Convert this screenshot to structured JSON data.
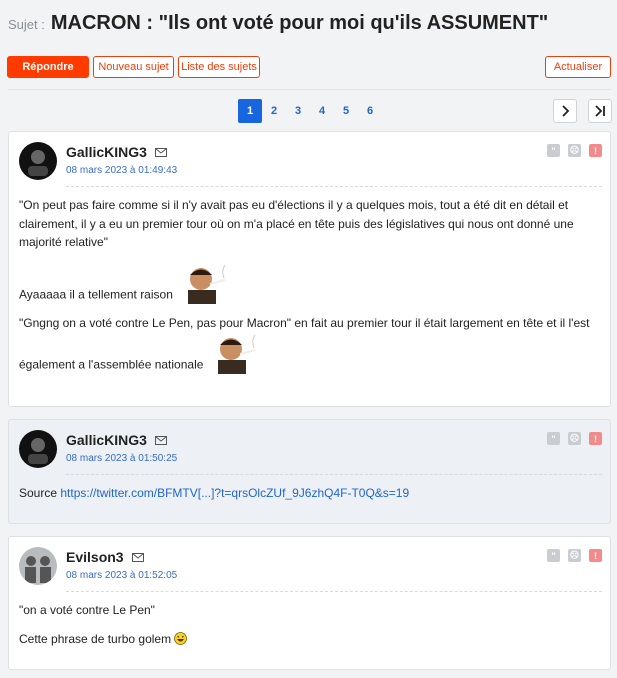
{
  "topic": {
    "subject_label": "Sujet :",
    "title": "MACRON : \"Ils ont voté pour moi qu'ils ASSUMENT\""
  },
  "toolbar": {
    "reply": "Répondre",
    "new_topic": "Nouveau sujet",
    "topic_list": "Liste des sujets",
    "refresh": "Actualiser"
  },
  "pagination": {
    "pages": [
      "1",
      "2",
      "3",
      "4",
      "5",
      "6"
    ],
    "current": "1"
  },
  "posts": [
    {
      "author": "GallicKING3",
      "date": "08 mars 2023 à 01:49:43",
      "paragraphs": [
        "\"On peut pas faire comme si il n'y avait pas eu d'élections il y a quelques mois, tout a été dit en détail et clairement, il y a eu un premier tour où on m'a placé en tête puis des législatives qui nous ont donné une majorité relative\"",
        "Ayaaaaa il a tellement raison",
        "\"Gngng on a voté contre Le Pen, pas pour Macron\" en fait au premier tour il était largement en tête et il l'est également a l'assemblée nationale"
      ]
    },
    {
      "author": "GallicKING3",
      "date": "08 mars 2023 à 01:50:25",
      "source_label": "Source",
      "source_link": "https://twitter.com/BFMTV[...]?t=qrsOlcZUf_9J6zhQ4F-T0Q&s=19"
    },
    {
      "author": "Evilson3",
      "date": "08 mars 2023 à 01:52:05",
      "paragraphs": [
        "\"on a voté contre Le Pen\"",
        "Cette phrase de turbo golem"
      ]
    }
  ],
  "colors": {
    "accent": "#ff3b00",
    "link": "#1f66c9",
    "page_active": "#1865e0"
  }
}
